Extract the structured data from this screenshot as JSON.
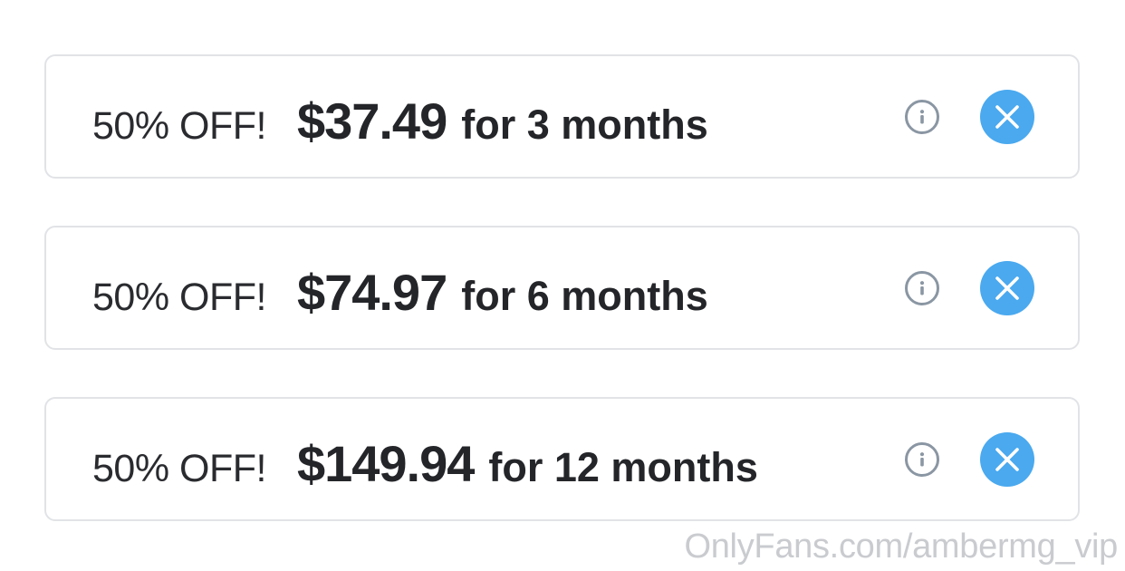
{
  "offers": [
    {
      "discount": "50% OFF!",
      "price": "$37.49",
      "duration": "for 3 months",
      "info_icon": "info-icon",
      "remove_icon": "close-icon"
    },
    {
      "discount": "50% OFF!",
      "price": "$74.97",
      "duration": "for 6 months",
      "info_icon": "info-icon",
      "remove_icon": "close-icon"
    },
    {
      "discount": "50% OFF!",
      "price": "$149.94",
      "duration": "for 12 months",
      "info_icon": "info-icon",
      "remove_icon": "close-icon"
    }
  ],
  "watermark": "OnlyFans.com/ambermg_vip",
  "colors": {
    "accent": "#4aa9ef",
    "border": "#e1e3e6",
    "text": "#242529",
    "icon_gray": "#8a96a3",
    "watermark": "#c9cbcf"
  }
}
